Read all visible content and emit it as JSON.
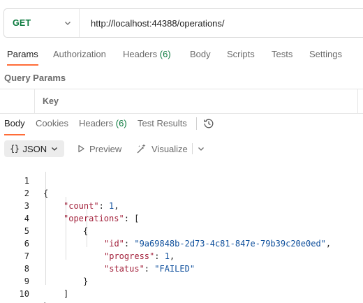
{
  "request": {
    "method": "GET",
    "url": "http://localhost:44388/operations/"
  },
  "request_tabs": [
    {
      "label": "Params",
      "active": true
    },
    {
      "label": "Authorization"
    },
    {
      "label": "Headers",
      "count": "(6)"
    },
    {
      "label": "Body"
    },
    {
      "label": "Scripts"
    },
    {
      "label": "Tests"
    },
    {
      "label": "Settings"
    }
  ],
  "query_params": {
    "title": "Query Params",
    "column_key": "Key"
  },
  "response_tabs": [
    {
      "label": "Body",
      "active": true
    },
    {
      "label": "Cookies"
    },
    {
      "label": "Headers",
      "count": "(6)"
    },
    {
      "label": "Test Results"
    }
  ],
  "toolbar": {
    "format_braces": "{}",
    "format_label": "JSON",
    "preview_label": "Preview",
    "visualize_label": "Visualize"
  },
  "code_lines": [
    {
      "n": "1"
    },
    {
      "n": "2"
    },
    {
      "n": "3"
    },
    {
      "n": "4"
    },
    {
      "n": "5"
    },
    {
      "n": "6"
    },
    {
      "n": "7"
    },
    {
      "n": "8"
    },
    {
      "n": "9"
    },
    {
      "n": "10"
    }
  ],
  "json_body": {
    "open_brace": "{",
    "count_key": "\"count\"",
    "count_value": "1",
    "operations_key": "\"operations\"",
    "open_bracket": "[",
    "item_open": "{",
    "id_key": "\"id\"",
    "id_value": "\"9a69848b-2d73-4c81-847e-79b39c20e0ed\"",
    "progress_key": "\"progress\"",
    "progress_value": "1",
    "status_key": "\"status\"",
    "status_value": "\"FAILED\"",
    "item_close": "}",
    "close_bracket": "]",
    "close_brace": "}"
  },
  "colors": {
    "method_get": "#0b7a3e",
    "active_tab_underline": "#ff6c37",
    "json_key": "#a3223c",
    "json_value": "#0e4f9c"
  }
}
